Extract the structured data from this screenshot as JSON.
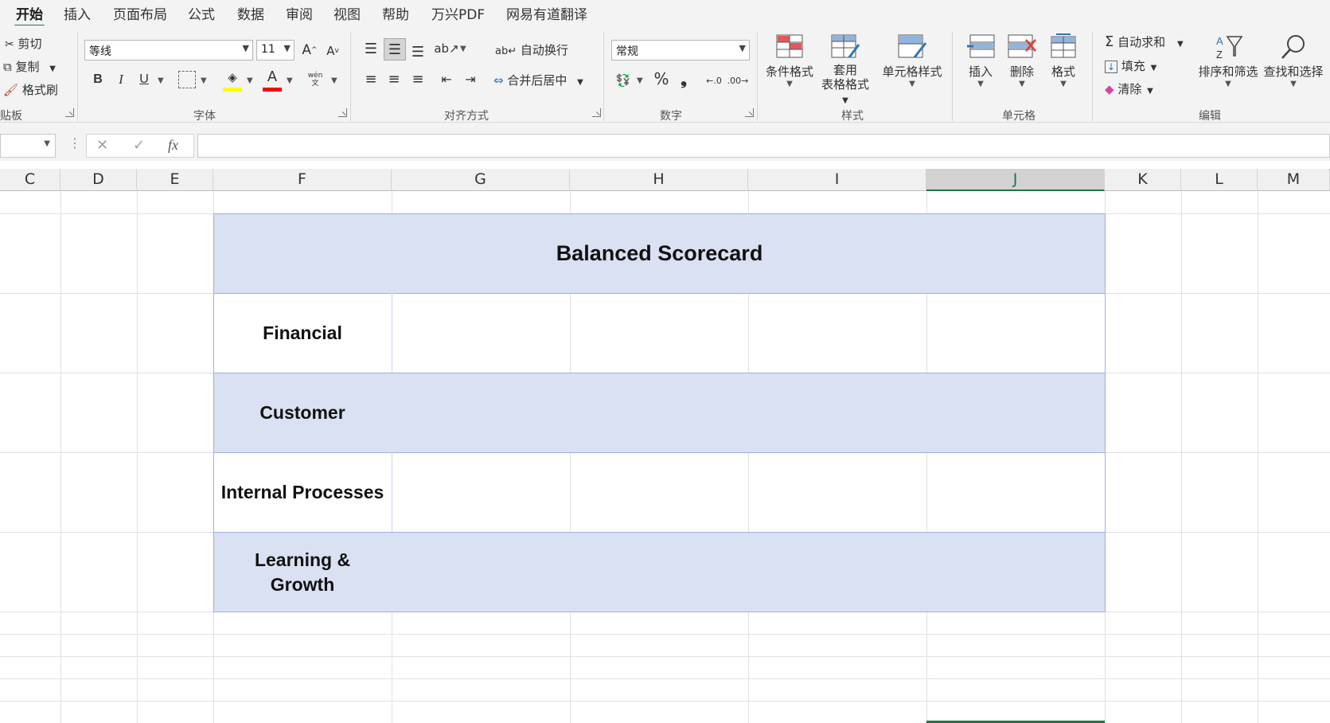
{
  "menu": {
    "tabs": [
      "开始",
      "插入",
      "页面布局",
      "公式",
      "数据",
      "审阅",
      "视图",
      "帮助",
      "万兴PDF",
      "网易有道翻译"
    ],
    "active_index": 0
  },
  "ribbon": {
    "clipboard": {
      "cut": "剪切",
      "copy": "复制",
      "format_painter": "格式刷",
      "label": "贴板"
    },
    "font": {
      "name": "等线",
      "size": "11",
      "label": "字体",
      "bold": "B",
      "italic": "I",
      "underline": "U",
      "phonetic": "wén"
    },
    "alignment": {
      "wrap_text": "自动换行",
      "merge_center": "合并后居中",
      "label": "对齐方式"
    },
    "number": {
      "format": "常规",
      "percent": "%",
      "comma": "❟",
      "label": "数字"
    },
    "styles": {
      "conditional": "条件格式",
      "table_line1": "套用",
      "table_line2": "表格格式",
      "cell_styles": "单元格样式",
      "label": "样式"
    },
    "cells": {
      "insert": "插入",
      "delete": "删除",
      "format": "格式",
      "label": "单元格"
    },
    "editing": {
      "autosum": "自动求和",
      "fill": "填充",
      "clear": "清除",
      "sort_filter": "排序和筛选",
      "find_select": "查找和选择",
      "label": "编辑"
    }
  },
  "formula_bar": {
    "name_box": "",
    "cancel": "✕",
    "enter": "✓",
    "fx": "fx",
    "content": ""
  },
  "columns": [
    "C",
    "D",
    "E",
    "F",
    "G",
    "H",
    "I",
    "J",
    "K",
    "L",
    "M"
  ],
  "selected_column": "J",
  "sheet": {
    "title": "Balanced Scorecard",
    "rows": [
      {
        "label": "Financial"
      },
      {
        "label": "Customer"
      },
      {
        "label": "Internal Processes"
      },
      {
        "label": "Learning & Growth"
      }
    ]
  },
  "colors": {
    "accent": "#217346",
    "band": "#dae1f2",
    "band_border": "#9fb0dc",
    "font_color_bar": "#ff0000",
    "highlight_bar": "#ffff00"
  }
}
